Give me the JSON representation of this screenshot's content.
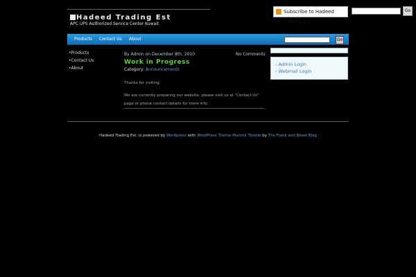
{
  "header": {
    "subscribe_label": "Subscribe to Hadeed Trading Est",
    "top_search_button": "Go",
    "site_title": "Hadeed Trading Est",
    "tagline": "APC UPS Authorized Service Center Kuwait"
  },
  "nav": {
    "items": [
      "Products",
      "Contact Us",
      "About"
    ],
    "search_button": "Go"
  },
  "leftnav": {
    "items": [
      "Products",
      "Contact Us",
      "About"
    ]
  },
  "post": {
    "meta": "By Admin on December 8th, 2010",
    "comments": "No Comments",
    "title": "Work in Progress",
    "category_label": "Category:",
    "category": "Announcements",
    "body_1": "Thanks for visiting.",
    "body_2": "We are currently preparing our website, please visit us at \"Contact Us\" page or phone contact details for more info."
  },
  "sidebar": {
    "links": [
      "Admin Login",
      "Webmail Login"
    ]
  },
  "footer": {
    "site": "Hadeed Trading Est.",
    "text_1": "is powered by",
    "wp": "Wordpress",
    "text_2": "with",
    "theme": "WordPress Theme Mumrik Theme",
    "text_3": "by",
    "author": "The Frank and Beast Blog"
  },
  "colors": {
    "nav_blue": "#1a82cc",
    "title_green": "#5fcf3b",
    "link_blue": "#5a9de0"
  }
}
